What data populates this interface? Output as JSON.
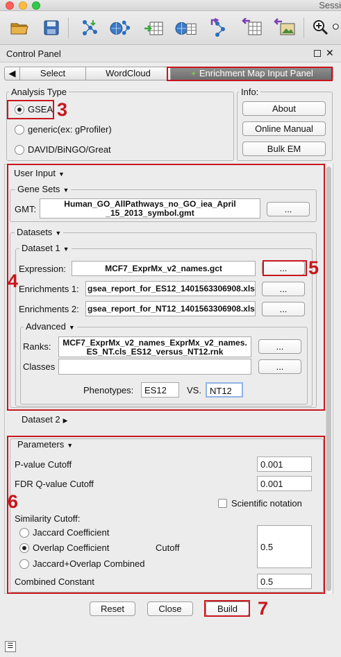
{
  "window": {
    "title": "Sessi"
  },
  "toolbar": {
    "icons": [
      "open-folder-icon",
      "save-icon",
      "network-import-icon",
      "network-web-import-icon",
      "table-import-icon",
      "web-table-import-icon",
      "network-export-icon",
      "table-export-icon",
      "image-export-icon",
      "zoom-in-icon",
      "zoom-out-icon"
    ]
  },
  "control_panel": {
    "title": "Control Panel"
  },
  "tabs": {
    "prev": "◀",
    "items": [
      "Select",
      "WordCloud",
      "Enrichment Map Input Panel"
    ]
  },
  "analysis_type": {
    "title": "Analysis Type",
    "options": [
      "GSEA",
      "generic(ex: gProfiler)",
      "DAVID/BiNGO/Great"
    ],
    "selected": "GSEA"
  },
  "info": {
    "title": "Info:",
    "buttons": [
      "About",
      "Online Manual",
      "Bulk EM"
    ]
  },
  "user_input": {
    "title": "User Input",
    "gene_sets": {
      "title": "Gene Sets",
      "gmt_label": "GMT:",
      "gmt_line1": "Human_GO_AllPathways_no_GO_iea_April",
      "gmt_line2": "_15_2013_symbol.gmt",
      "browse": "..."
    },
    "datasets": {
      "title": "Datasets",
      "dataset1": {
        "title": "Dataset 1",
        "expression_label": "Expression:",
        "expression_value": "MCF7_ExprMx_v2_names.gct",
        "enrich1_label": "Enrichments 1:",
        "enrich1_value": "gsea_report_for_ES12_1401563306908.xls",
        "enrich2_label": "Enrichments 2:",
        "enrich2_value": "gsea_report_for_NT12_1401563306908.xls",
        "browse": "...",
        "advanced": {
          "title": "Advanced",
          "ranks_label": "Ranks:",
          "ranks_line1": "MCF7_ExprMx_v2_names_ExprMx_v2_names.",
          "ranks_line2": "ES_NT.cls_ES12_versus_NT12.rnk",
          "classes_label": "Classes",
          "classes_value": "",
          "phenotypes_label": "Phenotypes:",
          "phenotype1": "ES12",
          "vs_label": "VS.",
          "phenotype2": "NT12"
        }
      },
      "dataset2": {
        "title": "Dataset 2"
      }
    }
  },
  "parameters": {
    "title": "Parameters",
    "pvalue_label": "P-value Cutoff",
    "pvalue": "0.001",
    "fdr_label": "FDR Q-value Cutoff",
    "fdr": "0.001",
    "scientific_label": "Scientific notation",
    "similarity_label": "Similarity Cutoff:",
    "similarity_options": [
      "Jaccard Coefficient",
      "Overlap Coefficient",
      "Jaccard+Overlap Combined"
    ],
    "similarity_selected": "Overlap Coefficient",
    "cutoff_label": "Cutoff",
    "cutoff": "0.5",
    "combined_label": "Combined Constant",
    "combined": "0.5"
  },
  "bottom_buttons": {
    "reset": "Reset",
    "close": "Close",
    "build": "Build"
  },
  "annotations": {
    "n3": "3",
    "n4": "4",
    "n5": "5",
    "n6": "6",
    "n7": "7"
  },
  "colors": {
    "annotation_red": "#c8161d",
    "active_tab": "#7a7a7a"
  }
}
